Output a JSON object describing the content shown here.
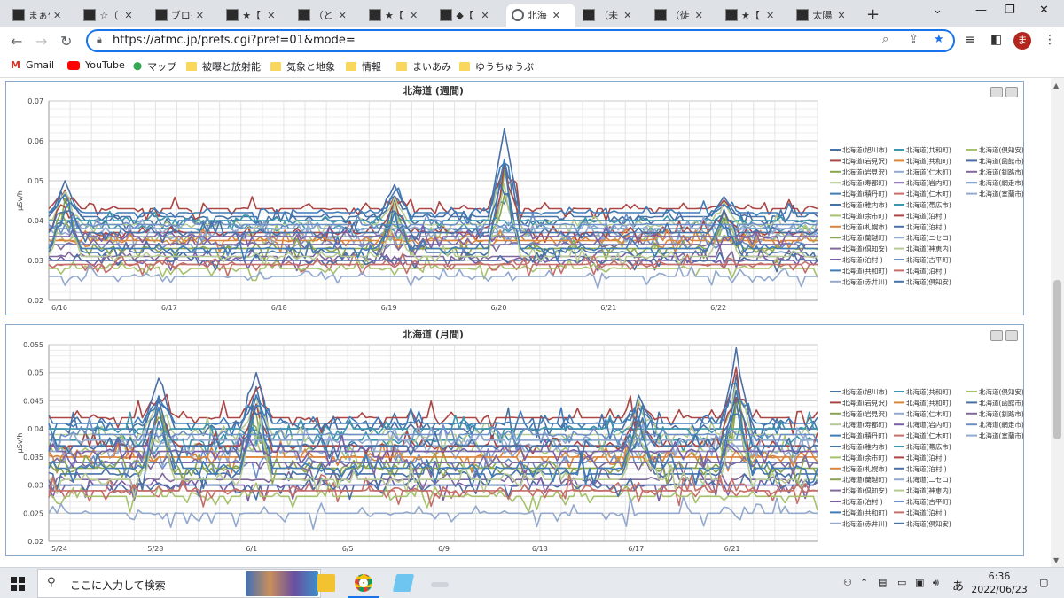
{
  "browser": {
    "tabs": [
      {
        "label": "まぁ偏",
        "icon": "site-favicon-icon",
        "active": false
      },
      {
        "label": "☆（",
        "icon": "site-favicon-icon",
        "active": false
      },
      {
        "label": "ブログ",
        "icon": "info-favicon-icon",
        "active": false
      },
      {
        "label": "★【",
        "icon": "site-favicon-icon",
        "active": false
      },
      {
        "label": "（と",
        "icon": "site-favicon-icon",
        "active": false
      },
      {
        "label": "★【",
        "icon": "site-favicon-icon",
        "active": false
      },
      {
        "label": "◆【",
        "icon": "site-favicon-icon",
        "active": false
      },
      {
        "label": "北海",
        "icon": "globe-icon",
        "active": true
      },
      {
        "label": "（未",
        "icon": "site-favicon-icon",
        "active": false
      },
      {
        "label": "（徒",
        "icon": "site-favicon-icon",
        "active": false
      },
      {
        "label": "★【",
        "icon": "site-favicon-icon",
        "active": false
      },
      {
        "label": "太陽",
        "icon": "site-favicon-icon",
        "active": false
      }
    ],
    "url": "https://atmc.jp/prefs.cgi?pref=01&mode=",
    "avatar_letter": "ま",
    "bookmarks": [
      {
        "label": "Gmail",
        "icon": "gmail-icon"
      },
      {
        "label": "YouTube",
        "icon": "youtube-icon"
      },
      {
        "label": "マップ",
        "icon": "maps-pin-icon"
      },
      {
        "label": "被曝と放射能",
        "icon": "folder-icon"
      },
      {
        "label": "気象と地象",
        "icon": "folder-icon"
      },
      {
        "label": "情報",
        "icon": "folder-icon"
      },
      {
        "label": "まいあみ",
        "icon": "folder-icon"
      },
      {
        "label": "ゆうちゅうぶ",
        "icon": "folder-icon"
      }
    ]
  },
  "legend_entries": [
    "北海道(旭川市)",
    "北海道(共和町)",
    "北海道(倶知安)",
    "北海道(岩見沢)",
    "北海道(共和町)",
    "北海道(函館市)",
    "北海道(岩見沢)",
    "北海道(仁木町)",
    "北海道(釧路市)",
    "北海道(寿都町)",
    "北海道(岩内町)",
    "北海道(網走市)",
    "北海道(積丹町)",
    "北海道(仁木町)",
    "北海道(室蘭市)",
    "北海道(稚内市)",
    "北海道(帯広市)",
    "北海道(余市町)",
    "北海道(泊村 )",
    "北海道(札幌市)",
    "北海道(泊村 )",
    "北海道(蘭越町)",
    "北海道(ニセコ)",
    "北海道(倶知安)",
    "北海道(神恵内)",
    "北海道(泊村 )",
    "北海道(古平町)",
    "北海道(共和町)",
    "北海道(泊村 )",
    "北海道(赤井川)",
    "北海道(倶知安)"
  ],
  "series_colors": [
    "#4572a7",
    "#3d96ae",
    "#a5c26b",
    "#aa4643",
    "#db843d",
    "#4a6fa5",
    "#89a54e",
    "#93a9cf",
    "#80699b",
    "#b5ca92",
    "#7b5fa8",
    "#6c8fc7",
    "#3e7bb8",
    "#c46f6a",
    "#92a8cd"
  ],
  "chart_data": [
    {
      "type": "line",
      "title": "北海道 (週間)",
      "ylabel": "μSv/h",
      "xlabel": "",
      "x_ticks": [
        "6/16",
        "6/17",
        "6/18",
        "6/19",
        "6/20",
        "6/21",
        "6/22"
      ],
      "y_ticks": [
        "0.02",
        "0.03",
        "0.04",
        "0.05",
        "0.06",
        "0.07"
      ],
      "ylim": [
        0.02,
        0.07
      ],
      "grid": true,
      "legend": "right",
      "series_base_values": [
        0.041,
        0.038,
        0.036,
        0.043,
        0.035,
        0.04,
        0.033,
        0.037,
        0.031,
        0.039,
        0.03,
        0.034,
        0.042,
        0.029,
        0.036,
        0.032,
        0.04,
        0.028,
        0.037,
        0.035,
        0.03,
        0.033,
        0.038,
        0.034,
        0.031,
        0.036,
        0.039,
        0.033,
        0.029,
        0.026,
        0.037
      ],
      "peaks": [
        {
          "x": "6/16",
          "value": 0.05
        },
        {
          "x": "6/19",
          "value": 0.049
        },
        {
          "x": "6/20",
          "value": 0.063
        },
        {
          "x": "6/22",
          "value": 0.046
        }
      ]
    },
    {
      "type": "line",
      "title": "北海道 (月間)",
      "ylabel": "μSv/h",
      "xlabel": "",
      "x_ticks": [
        "5/24",
        "5/28",
        "6/1",
        "6/5",
        "6/9",
        "6/13",
        "6/17",
        "6/21"
      ],
      "y_ticks": [
        "0.02",
        "0.025",
        "0.03",
        "0.035",
        "0.04",
        "0.045",
        "0.05",
        "0.055"
      ],
      "ylim": [
        0.02,
        0.055
      ],
      "grid": true,
      "legend": "right",
      "series_base_values": [
        0.041,
        0.038,
        0.036,
        0.042,
        0.035,
        0.04,
        0.033,
        0.037,
        0.031,
        0.039,
        0.03,
        0.034,
        0.041,
        0.029,
        0.036,
        0.032,
        0.04,
        0.028,
        0.037,
        0.035,
        0.03,
        0.033,
        0.038,
        0.034,
        0.031,
        0.036,
        0.039,
        0.033,
        0.029,
        0.025,
        0.037
      ],
      "peaks": [
        {
          "x": "5/28",
          "value": 0.049
        },
        {
          "x": "6/1",
          "value": 0.05
        },
        {
          "x": "6/17",
          "value": 0.046
        },
        {
          "x": "6/21",
          "value": 0.053
        }
      ]
    }
  ],
  "taskbar": {
    "search_placeholder": "ここに入力して検索",
    "ime": "あ",
    "time": "6:36",
    "date": "2022/06/23"
  }
}
